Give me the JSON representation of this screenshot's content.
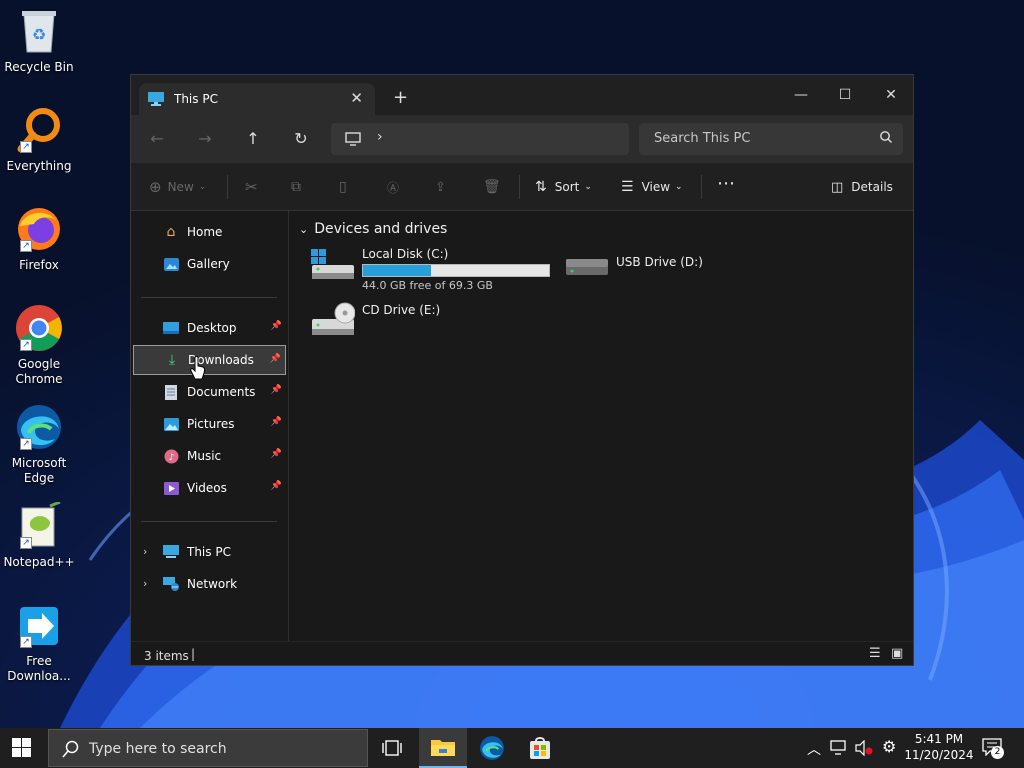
{
  "desktop": {
    "icons": [
      {
        "label": "Recycle Bin"
      },
      {
        "label": "Everything"
      },
      {
        "label": "Firefox"
      },
      {
        "label": "Google Chrome"
      },
      {
        "label": "Microsoft Edge"
      },
      {
        "label": "Notepad++"
      },
      {
        "label": "Free Downloa..."
      }
    ]
  },
  "explorer": {
    "tab_title": "This PC",
    "search_placeholder": "Search This PC",
    "toolbar": {
      "new_label": "New",
      "sort_label": "Sort",
      "view_label": "View",
      "details_label": "Details"
    },
    "sidebar": {
      "quick": [
        {
          "label": "Home"
        },
        {
          "label": "Gallery"
        }
      ],
      "pinned": [
        {
          "label": "Desktop"
        },
        {
          "label": "Downloads",
          "selected": true
        },
        {
          "label": "Documents"
        },
        {
          "label": "Pictures"
        },
        {
          "label": "Music"
        },
        {
          "label": "Videos"
        }
      ],
      "locations": [
        {
          "label": "This PC"
        },
        {
          "label": "Network"
        }
      ]
    },
    "content": {
      "group_title": "Devices and drives",
      "drives": [
        {
          "name": "Local Disk (C:)",
          "free_text": "44.0 GB free of 69.3 GB",
          "used_fraction": 0.365
        },
        {
          "name": "USB Drive (D:)"
        },
        {
          "name": "CD Drive (E:)"
        }
      ]
    },
    "status": {
      "item_count": "3 items"
    }
  },
  "taskbar": {
    "search_placeholder": "Type here to search",
    "time": "5:41 PM",
    "date": "11/20/2024",
    "notification_count": "2"
  },
  "colors": {
    "accent": "#26a0da",
    "window_bg": "#191919"
  }
}
